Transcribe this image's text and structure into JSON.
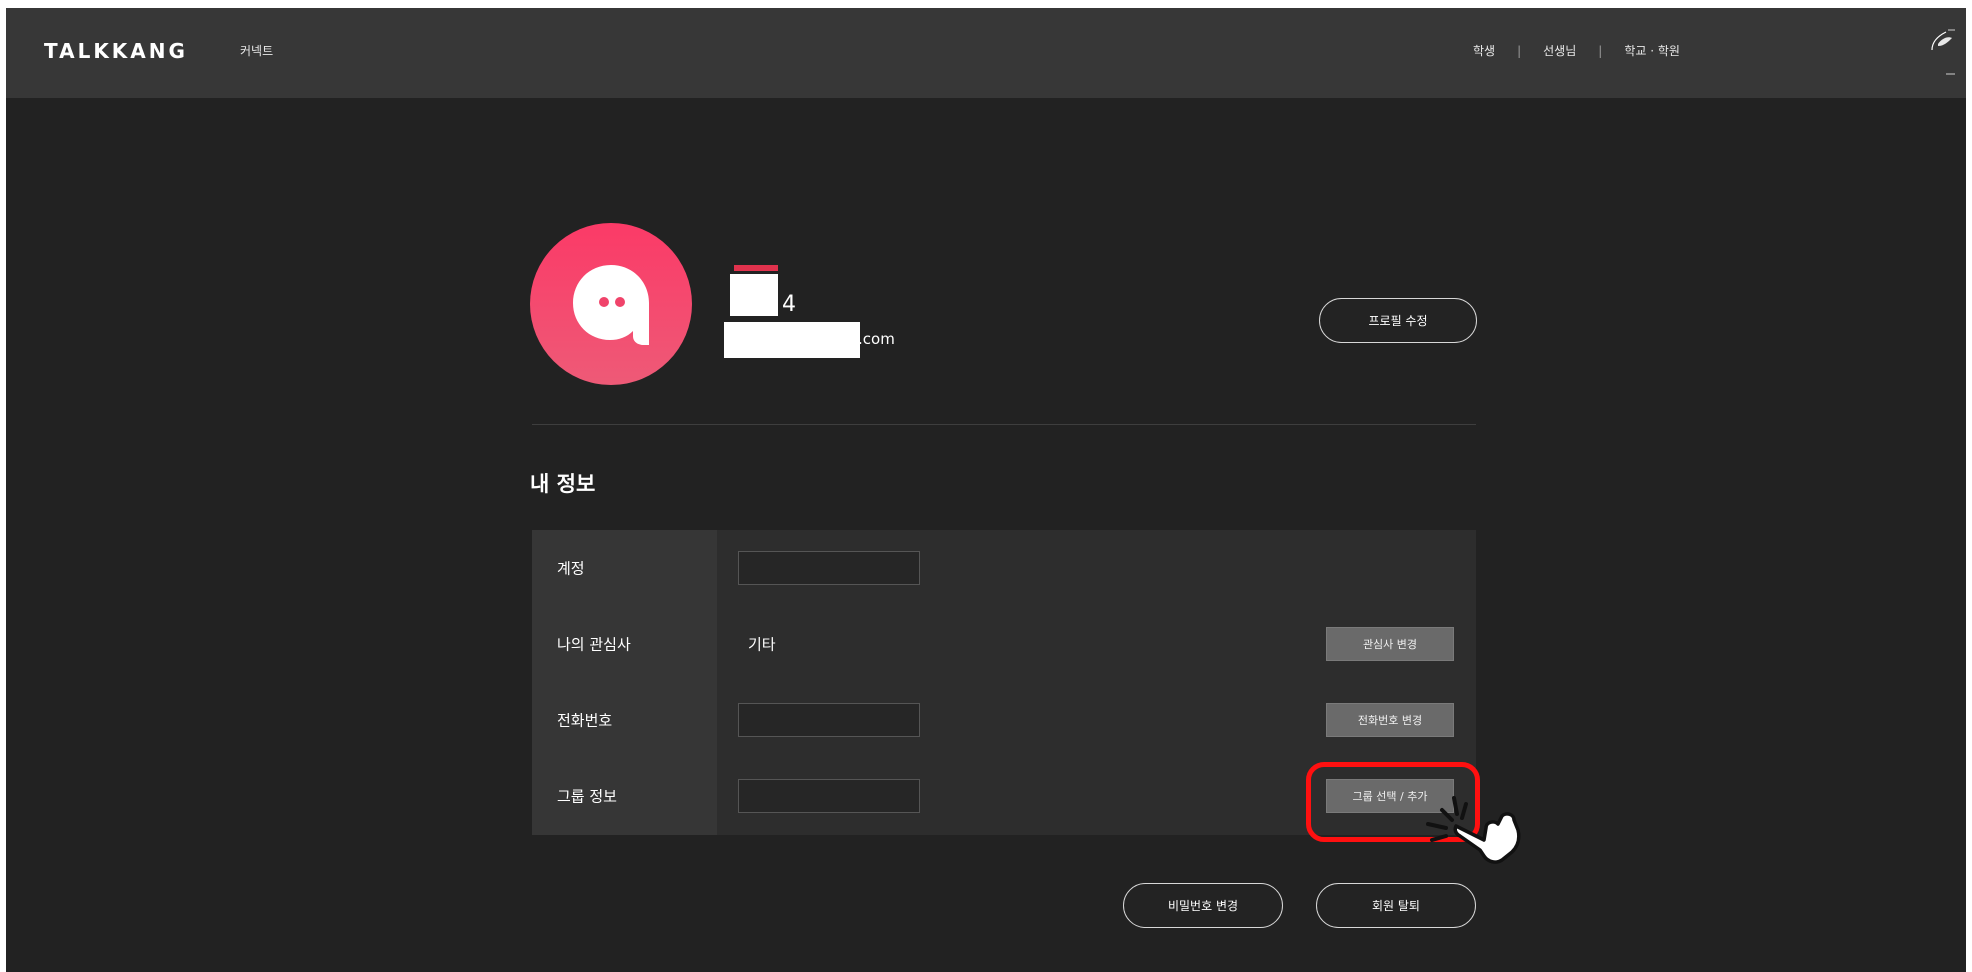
{
  "header": {
    "logo": "TALKKANG",
    "connect": "커넥트",
    "nav": [
      "학생",
      "선생님",
      "학교 · 학원"
    ],
    "separator": "|"
  },
  "profile": {
    "name": "4",
    "email": ".com",
    "edit_button": "프로필 수정"
  },
  "section_title": "내 정보",
  "info": {
    "rows": [
      {
        "label": "계정",
        "value": "",
        "button": ""
      },
      {
        "label": "나의 관심사",
        "value": "기타",
        "button": "관심사 변경"
      },
      {
        "label": "전화번호",
        "value": "",
        "button": "전화번호 변경"
      },
      {
        "label": "그룹 정보",
        "value": "",
        "button": "그룹 선택 / 추가"
      }
    ]
  },
  "footer_buttons": {
    "change_password": "비밀번호 변경",
    "withdraw": "회원 탈퇴"
  },
  "colors": {
    "brand_pink": "#f0436a",
    "highlight_red": "#ff1010",
    "background": "#222222"
  },
  "icons": {
    "profile_avatar": "talkkang-a-logo-icon",
    "annotation_cursor": "hand-pointer-click-icon"
  }
}
